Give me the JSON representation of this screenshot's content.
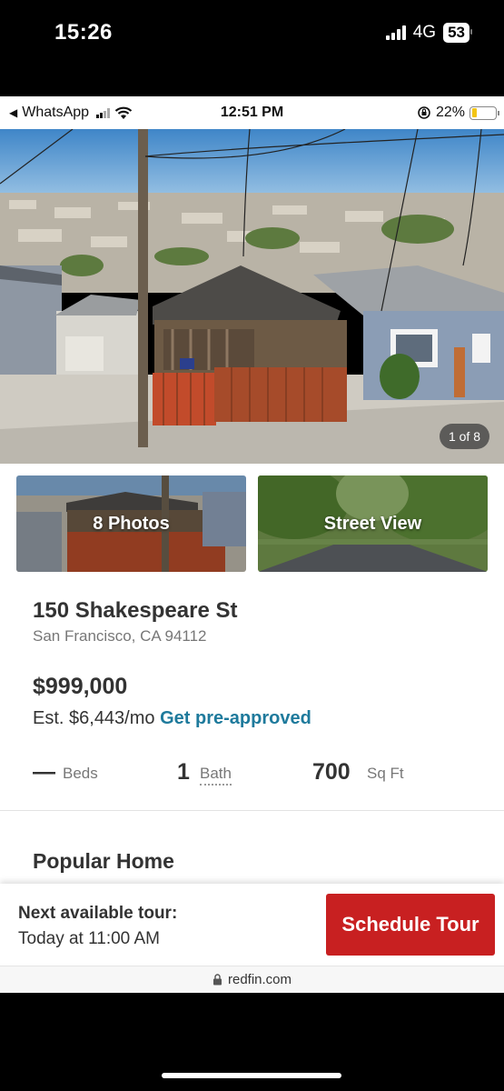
{
  "outer_status": {
    "time": "15:26",
    "network": "4G",
    "battery": "53"
  },
  "inner_status": {
    "back_app": "WhatsApp",
    "time": "12:51 PM",
    "battery_percent": "22%"
  },
  "hero": {
    "photo_counter": "1 of 8"
  },
  "thumbnails": {
    "photos_label": "8 Photos",
    "street_view_label": "Street View"
  },
  "listing": {
    "address": "150 Shakespeare St",
    "city": "San Francisco, CA 94112",
    "price": "$999,000",
    "est_payment": "Est. $6,443/mo",
    "preapproved_link": "Get pre-approved",
    "beds_value": "—",
    "beds_label": "Beds",
    "bath_value": "1",
    "bath_label": "Bath",
    "sqft_value": "700",
    "sqft_label": "Sq Ft",
    "section_title": "Popular Home"
  },
  "tour": {
    "title": "Next available tour:",
    "time": "Today at 11:00 AM",
    "button": "Schedule Tour"
  },
  "browser": {
    "url": "redfin.com"
  },
  "colors": {
    "brand_red": "#c82021",
    "link_blue": "#1e7a9c"
  }
}
